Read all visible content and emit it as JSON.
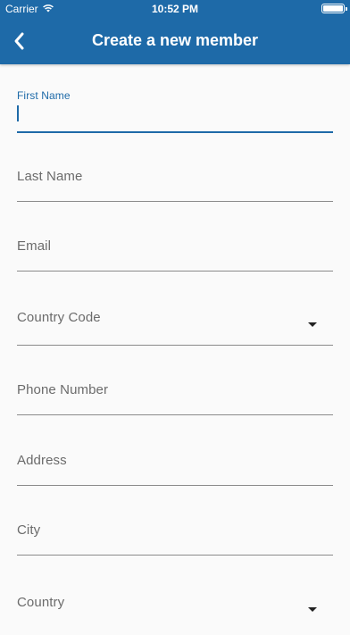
{
  "status_bar": {
    "carrier": "Carrier",
    "time": "10:52 PM",
    "wifi_icon": "wifi-icon",
    "battery_icon": "battery-icon"
  },
  "app_bar": {
    "title": "Create a new member",
    "back_icon": "chevron-left-icon",
    "background_color": "#1e6aa8"
  },
  "form": {
    "first_name_label": "First Name",
    "first_name_value": "",
    "last_name_label": "Last Name",
    "email_label": "Email",
    "country_code_label": "Country Code",
    "phone_label": "Phone Number",
    "address_label": "Address",
    "city_label": "City",
    "country_label": "Country",
    "dropdown_icon": "arrow-drop-down-icon"
  }
}
